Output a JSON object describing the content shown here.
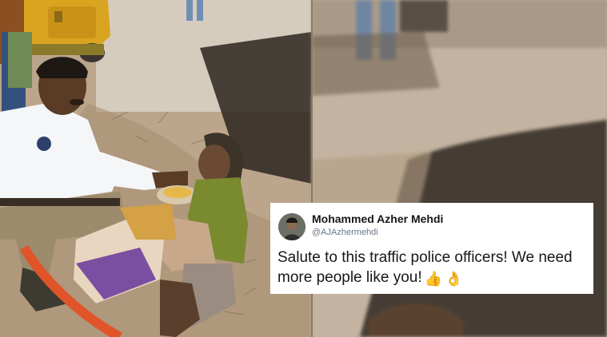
{
  "tweet": {
    "author_name": "Mohammed Azher Mehdi",
    "author_handle": "@AJAzhermehdi",
    "text": "Salute to this traffic police officers! We need more people like you!",
    "emojis": [
      "thumbs-up-emoji",
      "ok-hand-emoji"
    ]
  },
  "photo": {
    "left_panel": "traffic-police-officer-feeding-elderly-woman",
    "right_panel": "blurred-zoomed-background"
  },
  "colors": {
    "tweet_background": "#ffffff",
    "name_text": "#14171a",
    "handle_text": "#657786",
    "uniform": "#f4f6f8",
    "sweater": "#7a8a2e",
    "auto_rickshaw": "#d9a520",
    "ground": "#b9a48b"
  }
}
